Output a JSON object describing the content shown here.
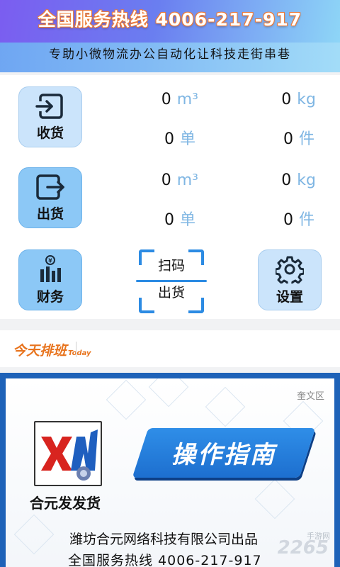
{
  "banner": {
    "hotline": "全国服务热线  4006-217-917",
    "slogan": "专助小微物流办公自动化让科技走街串巷"
  },
  "receive": {
    "label": "收货",
    "volume": "0",
    "volume_unit": "m³",
    "weight": "0",
    "weight_unit": "kg",
    "orders": "0",
    "orders_unit": "单",
    "pieces": "0",
    "pieces_unit": "件"
  },
  "ship": {
    "label": "出货",
    "volume": "0",
    "volume_unit": "m³",
    "weight": "0",
    "weight_unit": "kg",
    "orders": "0",
    "orders_unit": "单",
    "pieces": "0",
    "pieces_unit": "件"
  },
  "finance": {
    "label": "财务"
  },
  "scan": {
    "line1": "扫码",
    "line2": "出货"
  },
  "settings": {
    "label": "设置"
  },
  "today": {
    "logo_text": "今天",
    "logo_highlight": "排班",
    "logo_sub": "Today"
  },
  "guide": {
    "region": "奎文区",
    "company": "合元发发货",
    "title": "操作指南",
    "producer": "潍坊合元网络科技有限公司出品",
    "hotline": "全国服务热线    4006-217-917"
  },
  "watermark": {
    "main": "2265",
    "sub": "手游网"
  },
  "colors": {
    "accent": "#2c8be3",
    "unit": "#7fb6e3",
    "brand_orange": "#e8741e"
  }
}
